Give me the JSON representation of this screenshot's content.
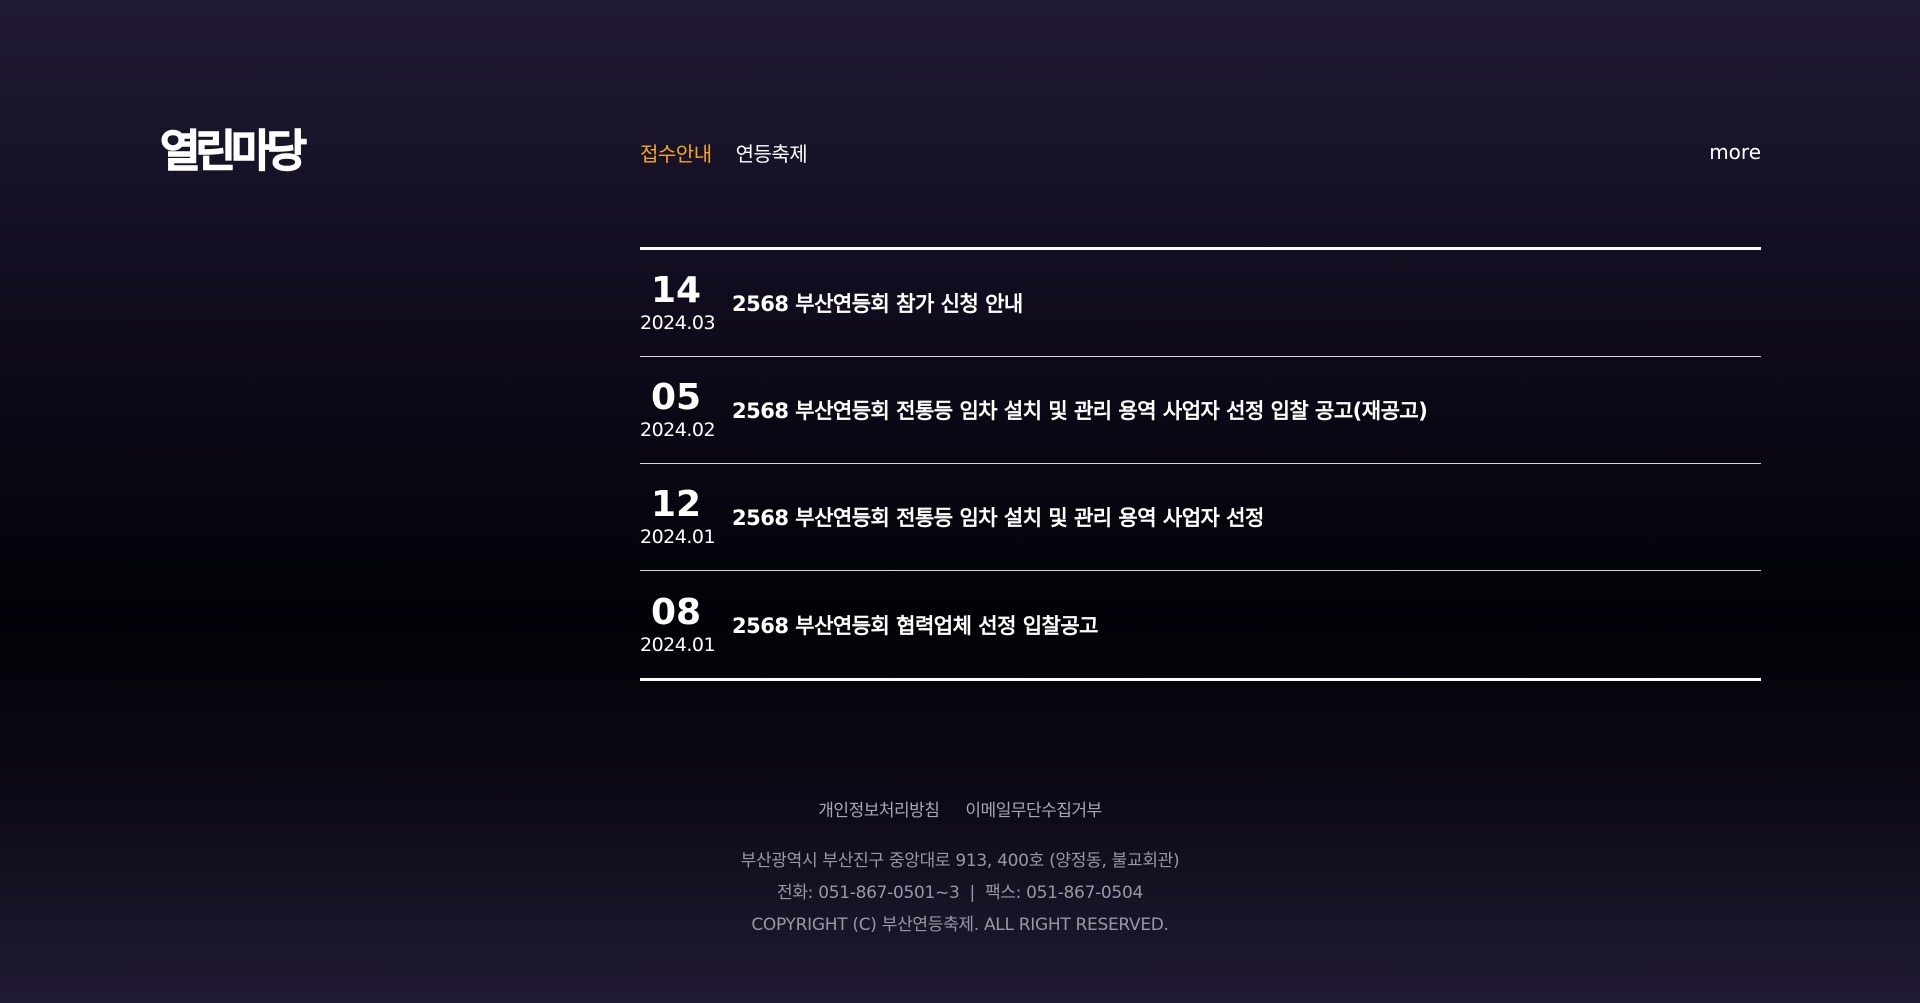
{
  "section": {
    "title": "열린마당"
  },
  "board": {
    "tabs": [
      {
        "label": "접수안내",
        "active": true
      },
      {
        "label": "연등축제",
        "active": false
      }
    ],
    "more_label": "more",
    "posts": [
      {
        "day": "14",
        "year_month": "2024.03",
        "title": "2568 부산연등회 참가 신청 안내"
      },
      {
        "day": "05",
        "year_month": "2024.02",
        "title": "2568 부산연등회 전통등 임차 설치 및 관리 용역 사업자 선정 입찰 공고(재공고)"
      },
      {
        "day": "12",
        "year_month": "2024.01",
        "title": "2568 부산연등회 전통등 임차 설치 및 관리 용역 사업자 선정"
      },
      {
        "day": "08",
        "year_month": "2024.01",
        "title": "2568 부산연등회 협력업체 선정 입찰공고"
      }
    ]
  },
  "footer": {
    "links": [
      "개인정보처리방침",
      "이메일무단수집거부"
    ],
    "address": "부산광역시 부산진구 중앙대로 913, 400호 (양정동, 불교회관)",
    "phone": "전화: 051-867-0501~3",
    "separator": "|",
    "fax": "팩스: 051-867-0504",
    "copyright": "COPYRIGHT (C) 부산연등축제. ALL RIGHT RESERVED."
  },
  "colors": {
    "accent": "#f5a623",
    "text": "#ffffff",
    "footer_text": "#9a96a4"
  }
}
